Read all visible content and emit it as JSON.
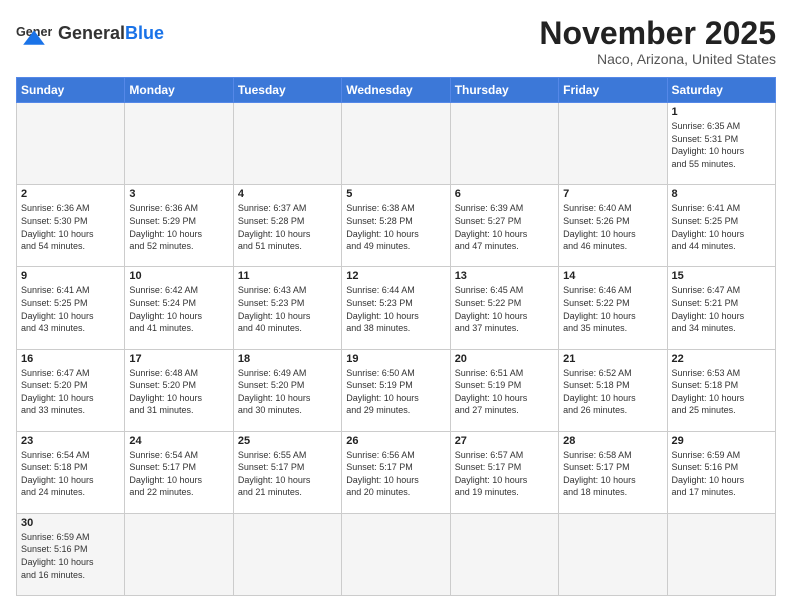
{
  "header": {
    "logo_general": "General",
    "logo_blue": "Blue",
    "month_title": "November 2025",
    "location": "Naco, Arizona, United States"
  },
  "weekdays": [
    "Sunday",
    "Monday",
    "Tuesday",
    "Wednesday",
    "Thursday",
    "Friday",
    "Saturday"
  ],
  "weeks": [
    [
      {
        "day": "",
        "info": ""
      },
      {
        "day": "",
        "info": ""
      },
      {
        "day": "",
        "info": ""
      },
      {
        "day": "",
        "info": ""
      },
      {
        "day": "",
        "info": ""
      },
      {
        "day": "",
        "info": ""
      },
      {
        "day": "1",
        "info": "Sunrise: 6:35 AM\nSunset: 5:31 PM\nDaylight: 10 hours\nand 55 minutes."
      }
    ],
    [
      {
        "day": "2",
        "info": "Sunrise: 6:36 AM\nSunset: 5:30 PM\nDaylight: 10 hours\nand 54 minutes."
      },
      {
        "day": "3",
        "info": "Sunrise: 6:36 AM\nSunset: 5:29 PM\nDaylight: 10 hours\nand 52 minutes."
      },
      {
        "day": "4",
        "info": "Sunrise: 6:37 AM\nSunset: 5:28 PM\nDaylight: 10 hours\nand 51 minutes."
      },
      {
        "day": "5",
        "info": "Sunrise: 6:38 AM\nSunset: 5:28 PM\nDaylight: 10 hours\nand 49 minutes."
      },
      {
        "day": "6",
        "info": "Sunrise: 6:39 AM\nSunset: 5:27 PM\nDaylight: 10 hours\nand 47 minutes."
      },
      {
        "day": "7",
        "info": "Sunrise: 6:40 AM\nSunset: 5:26 PM\nDaylight: 10 hours\nand 46 minutes."
      },
      {
        "day": "8",
        "info": "Sunrise: 6:41 AM\nSunset: 5:25 PM\nDaylight: 10 hours\nand 44 minutes."
      }
    ],
    [
      {
        "day": "9",
        "info": "Sunrise: 6:41 AM\nSunset: 5:25 PM\nDaylight: 10 hours\nand 43 minutes."
      },
      {
        "day": "10",
        "info": "Sunrise: 6:42 AM\nSunset: 5:24 PM\nDaylight: 10 hours\nand 41 minutes."
      },
      {
        "day": "11",
        "info": "Sunrise: 6:43 AM\nSunset: 5:23 PM\nDaylight: 10 hours\nand 40 minutes."
      },
      {
        "day": "12",
        "info": "Sunrise: 6:44 AM\nSunset: 5:23 PM\nDaylight: 10 hours\nand 38 minutes."
      },
      {
        "day": "13",
        "info": "Sunrise: 6:45 AM\nSunset: 5:22 PM\nDaylight: 10 hours\nand 37 minutes."
      },
      {
        "day": "14",
        "info": "Sunrise: 6:46 AM\nSunset: 5:22 PM\nDaylight: 10 hours\nand 35 minutes."
      },
      {
        "day": "15",
        "info": "Sunrise: 6:47 AM\nSunset: 5:21 PM\nDaylight: 10 hours\nand 34 minutes."
      }
    ],
    [
      {
        "day": "16",
        "info": "Sunrise: 6:47 AM\nSunset: 5:20 PM\nDaylight: 10 hours\nand 33 minutes."
      },
      {
        "day": "17",
        "info": "Sunrise: 6:48 AM\nSunset: 5:20 PM\nDaylight: 10 hours\nand 31 minutes."
      },
      {
        "day": "18",
        "info": "Sunrise: 6:49 AM\nSunset: 5:20 PM\nDaylight: 10 hours\nand 30 minutes."
      },
      {
        "day": "19",
        "info": "Sunrise: 6:50 AM\nSunset: 5:19 PM\nDaylight: 10 hours\nand 29 minutes."
      },
      {
        "day": "20",
        "info": "Sunrise: 6:51 AM\nSunset: 5:19 PM\nDaylight: 10 hours\nand 27 minutes."
      },
      {
        "day": "21",
        "info": "Sunrise: 6:52 AM\nSunset: 5:18 PM\nDaylight: 10 hours\nand 26 minutes."
      },
      {
        "day": "22",
        "info": "Sunrise: 6:53 AM\nSunset: 5:18 PM\nDaylight: 10 hours\nand 25 minutes."
      }
    ],
    [
      {
        "day": "23",
        "info": "Sunrise: 6:54 AM\nSunset: 5:18 PM\nDaylight: 10 hours\nand 24 minutes."
      },
      {
        "day": "24",
        "info": "Sunrise: 6:54 AM\nSunset: 5:17 PM\nDaylight: 10 hours\nand 22 minutes."
      },
      {
        "day": "25",
        "info": "Sunrise: 6:55 AM\nSunset: 5:17 PM\nDaylight: 10 hours\nand 21 minutes."
      },
      {
        "day": "26",
        "info": "Sunrise: 6:56 AM\nSunset: 5:17 PM\nDaylight: 10 hours\nand 20 minutes."
      },
      {
        "day": "27",
        "info": "Sunrise: 6:57 AM\nSunset: 5:17 PM\nDaylight: 10 hours\nand 19 minutes."
      },
      {
        "day": "28",
        "info": "Sunrise: 6:58 AM\nSunset: 5:17 PM\nDaylight: 10 hours\nand 18 minutes."
      },
      {
        "day": "29",
        "info": "Sunrise: 6:59 AM\nSunset: 5:16 PM\nDaylight: 10 hours\nand 17 minutes."
      }
    ],
    [
      {
        "day": "30",
        "info": "Sunrise: 6:59 AM\nSunset: 5:16 PM\nDaylight: 10 hours\nand 16 minutes."
      },
      {
        "day": "",
        "info": ""
      },
      {
        "day": "",
        "info": ""
      },
      {
        "day": "",
        "info": ""
      },
      {
        "day": "",
        "info": ""
      },
      {
        "day": "",
        "info": ""
      },
      {
        "day": "",
        "info": ""
      }
    ]
  ]
}
